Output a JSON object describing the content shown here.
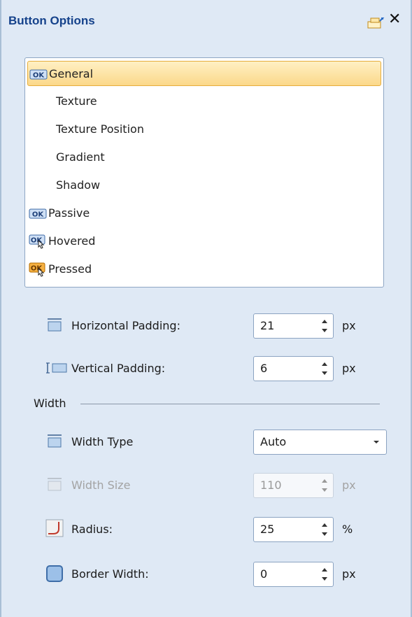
{
  "panel": {
    "title": "Button Options"
  },
  "list": {
    "items": [
      {
        "label": "General",
        "icon": "ok-button-icon",
        "selected": true
      },
      {
        "label": "Texture",
        "icon": null
      },
      {
        "label": "Texture Position",
        "icon": null
      },
      {
        "label": "Gradient",
        "icon": null
      },
      {
        "label": "Shadow",
        "icon": null
      },
      {
        "label": "Passive",
        "icon": "ok-button-icon"
      },
      {
        "label": "Hovered",
        "icon": "ok-button-hover-icon"
      },
      {
        "label": "Pressed",
        "icon": "ok-button-pressed-icon"
      }
    ]
  },
  "fields": {
    "horizontal_padding": {
      "label": "Horizontal Padding:",
      "value": "21",
      "unit": "px"
    },
    "vertical_padding": {
      "label": "Vertical Padding:",
      "value": "6",
      "unit": "px"
    },
    "width_group": {
      "label": "Width"
    },
    "width_type": {
      "label": "Width Type",
      "value": "Auto"
    },
    "width_size": {
      "label": "Width Size",
      "value": "110",
      "unit": "px",
      "disabled": true
    },
    "radius": {
      "label": "Radius:",
      "value": "25",
      "unit": "%"
    },
    "border_width": {
      "label": "Border Width:",
      "value": "0",
      "unit": "px"
    }
  },
  "colors": {
    "panel_bg": "#dfe9f5",
    "title": "#15428b",
    "selection_border": "#e6ad3c",
    "selection_fill": "#fbd88a"
  }
}
